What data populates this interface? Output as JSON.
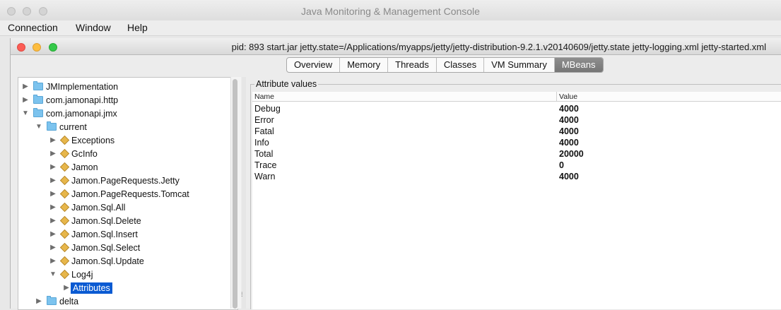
{
  "outer_window": {
    "title": "Java Monitoring & Management Console"
  },
  "menubar": {
    "items": [
      "Connection",
      "Window",
      "Help"
    ]
  },
  "inner_window": {
    "title": "pid: 893 start.jar jetty.state=/Applications/myapps/jetty/jetty-distribution-9.2.1.v20140609/jetty.state jetty-logging.xml jetty-started.xml"
  },
  "tabs": [
    {
      "label": "Overview",
      "active": false
    },
    {
      "label": "Memory",
      "active": false
    },
    {
      "label": "Threads",
      "active": false
    },
    {
      "label": "Classes",
      "active": false
    },
    {
      "label": "VM Summary",
      "active": false
    },
    {
      "label": "MBeans",
      "active": true
    }
  ],
  "tree": {
    "items": [
      {
        "label": "JMImplementation",
        "icon": "folder-icon",
        "expanded": false,
        "level": 0
      },
      {
        "label": "com.jamonapi.http",
        "icon": "folder-icon",
        "expanded": false,
        "level": 0
      },
      {
        "label": "com.jamonapi.jmx",
        "icon": "folder-icon",
        "expanded": true,
        "level": 0
      },
      {
        "label": "current",
        "icon": "folder-icon",
        "expanded": true,
        "level": 1
      },
      {
        "label": "Exceptions",
        "icon": "mbean-icon",
        "expanded": false,
        "level": 2
      },
      {
        "label": "GcInfo",
        "icon": "mbean-icon",
        "expanded": false,
        "level": 2
      },
      {
        "label": "Jamon",
        "icon": "mbean-icon",
        "expanded": false,
        "level": 2
      },
      {
        "label": "Jamon.PageRequests.Jetty",
        "icon": "mbean-icon",
        "expanded": false,
        "level": 2
      },
      {
        "label": "Jamon.PageRequests.Tomcat",
        "icon": "mbean-icon",
        "expanded": false,
        "level": 2
      },
      {
        "label": "Jamon.Sql.All",
        "icon": "mbean-icon",
        "expanded": false,
        "level": 2
      },
      {
        "label": "Jamon.Sql.Delete",
        "icon": "mbean-icon",
        "expanded": false,
        "level": 2
      },
      {
        "label": "Jamon.Sql.Insert",
        "icon": "mbean-icon",
        "expanded": false,
        "level": 2
      },
      {
        "label": "Jamon.Sql.Select",
        "icon": "mbean-icon",
        "expanded": false,
        "level": 2
      },
      {
        "label": "Jamon.Sql.Update",
        "icon": "mbean-icon",
        "expanded": false,
        "level": 2
      },
      {
        "label": "Log4j",
        "icon": "mbean-icon",
        "expanded": true,
        "level": 2
      },
      {
        "label": "Attributes",
        "icon": "",
        "expanded": false,
        "level": 3,
        "selected": true
      },
      {
        "label": "delta",
        "icon": "folder-icon",
        "expanded": false,
        "level": 1
      }
    ]
  },
  "attributes": {
    "legend": "Attribute values",
    "columns": [
      "Name",
      "Value"
    ],
    "rows": [
      {
        "name": "Debug",
        "value": "4000"
      },
      {
        "name": "Error",
        "value": "4000"
      },
      {
        "name": "Fatal",
        "value": "4000"
      },
      {
        "name": "Info",
        "value": "4000"
      },
      {
        "name": "Total",
        "value": "20000"
      },
      {
        "name": "Trace",
        "value": "0"
      },
      {
        "name": "Warn",
        "value": "4000"
      }
    ]
  }
}
